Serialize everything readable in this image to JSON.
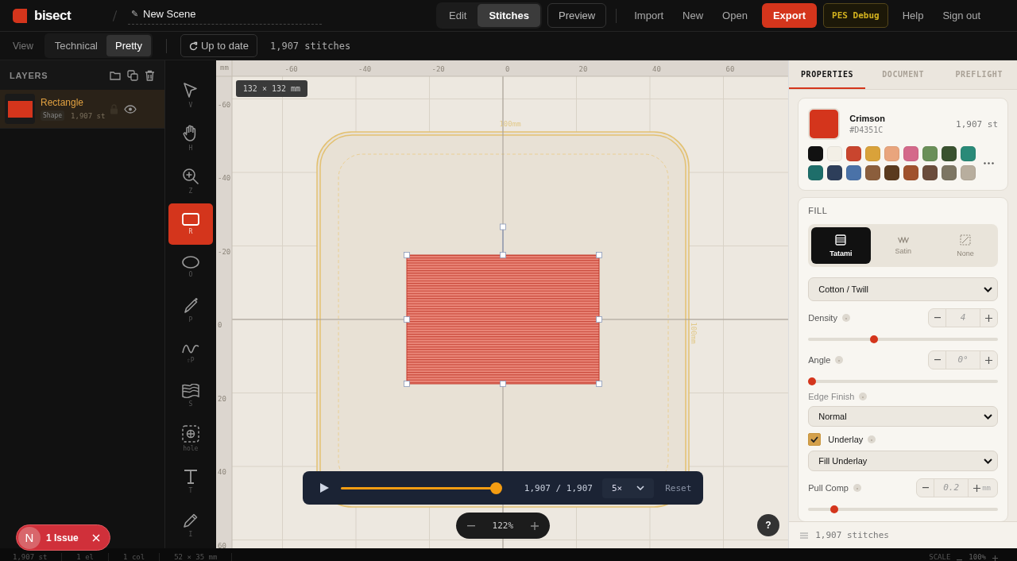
{
  "header": {
    "logo": "bisect",
    "scene_icon": "✎",
    "scene_title": "New Scene",
    "modes": [
      {
        "label": "Edit",
        "selected": false
      },
      {
        "label": "Stitches",
        "selected": true
      }
    ],
    "preview": "Preview",
    "nav": [
      "Import",
      "New",
      "Open"
    ],
    "export": "Export",
    "debug": "PES Debug",
    "links": [
      "Help",
      "Sign out"
    ]
  },
  "toolbar": {
    "view_label": "View",
    "view_options": [
      {
        "label": "Technical",
        "selected": false
      },
      {
        "label": "Pretty",
        "selected": true
      }
    ],
    "status_button": "Up to date",
    "stitch_count": "1,907 stitches"
  },
  "layers": {
    "title": "LAYERS",
    "items": [
      {
        "name": "Rectangle",
        "tag": "Shape",
        "count": "1,907 st",
        "color": "#d4351c",
        "selected": true
      }
    ]
  },
  "tools": [
    {
      "kind": "pointer",
      "key": "V",
      "selected": false
    },
    {
      "kind": "hand",
      "key": "H",
      "selected": false
    },
    {
      "kind": "zoom",
      "key": "Z",
      "selected": false
    },
    {
      "kind": "rect",
      "key": "R",
      "selected": true
    },
    {
      "kind": "ellipse",
      "key": "O",
      "selected": false
    },
    {
      "kind": "pen",
      "key": "P",
      "selected": false
    },
    {
      "kind": "curve",
      "key": "⇧P",
      "selected": false
    },
    {
      "kind": "satin",
      "key": "S",
      "selected": false
    },
    {
      "kind": "hole",
      "key": "hole",
      "selected": false
    },
    {
      "kind": "text",
      "key": "T",
      "selected": false
    },
    {
      "kind": "pencil",
      "key": "I",
      "selected": false
    }
  ],
  "canvas": {
    "ruler_unit": "mm",
    "x_ticks": [
      "-60",
      "-40",
      "-20",
      "0",
      "20",
      "40",
      "60"
    ],
    "y_ticks": [
      "-60",
      "-40",
      "-20",
      "0",
      "20",
      "40",
      "60"
    ],
    "size_badge": "132 × 132 mm",
    "hoop_label_top": "100mm",
    "hoop_label_side": "100mm",
    "playback": {
      "level": 1,
      "counter": "1,907 / 1,907",
      "speed": "5×",
      "reset": "Reset"
    },
    "zoom": "122%",
    "help": "?"
  },
  "issues": {
    "avatar": "N",
    "label": "1 Issue"
  },
  "panel": {
    "tabs": [
      {
        "label": "PROPERTIES",
        "selected": true
      },
      {
        "label": "DOCUMENT",
        "selected": false
      },
      {
        "label": "PREFLIGHT",
        "selected": false
      }
    ],
    "thread": {
      "name": "Crimson",
      "hex": "#D4351C",
      "color": "#d4351c",
      "count": "1,907 st",
      "swatches": [
        {
          "color": "#111111"
        },
        {
          "color": "#f3efe6"
        },
        {
          "color": "#c9452e"
        },
        {
          "color": "#d9a23a"
        },
        {
          "color": "#e9a57d"
        },
        {
          "color": "#d4698a"
        },
        {
          "color": "#6a8f58"
        },
        {
          "color": "#3a5230"
        },
        {
          "color": "#2a8a78"
        },
        {
          "color": "#1e6e6a"
        },
        {
          "color": "#2d3e5a"
        },
        {
          "color": "#4a72a8"
        },
        {
          "color": "#8b5e3c"
        },
        {
          "color": "#5a3a1e"
        },
        {
          "color": "#a0522d"
        },
        {
          "color": "#6b4c3b"
        },
        {
          "color": "#7d7663"
        },
        {
          "color": "#b8ae9e"
        }
      ]
    },
    "fill": {
      "title": "FILL",
      "types": [
        {
          "kind": "tatami",
          "label": "Tatami",
          "selected": true
        },
        {
          "kind": "satin",
          "label": "Satin",
          "selected": false
        },
        {
          "kind": "none",
          "label": "None",
          "selected": false
        }
      ],
      "fabric": "Cotton / Twill",
      "density": {
        "label": "Density",
        "value": "4",
        "level": 0.34
      },
      "angle": {
        "label": "Angle",
        "value": "0°",
        "level": 0
      },
      "edge_finish": {
        "label": "Edge Finish",
        "value": "Normal"
      },
      "underlay": {
        "label": "Underlay",
        "checked": true,
        "value": "Fill Underlay"
      },
      "pull_comp": {
        "label": "Pull Comp",
        "value": "0.2",
        "unit": "mm",
        "level": 0.12
      }
    },
    "footer": "1,907 stitches"
  },
  "status_bar": {
    "items": [
      "1,907 st",
      "1 el",
      "1 col",
      "52 × 35 mm"
    ],
    "scale_label": "SCALE",
    "scale_value": "100%"
  }
}
